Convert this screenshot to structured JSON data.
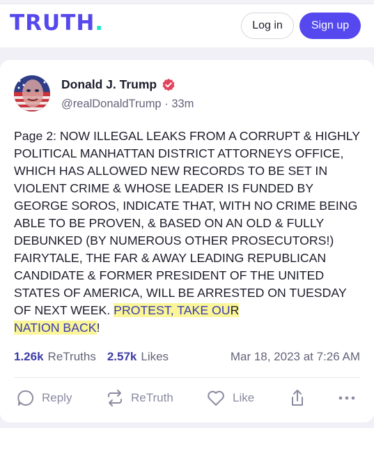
{
  "header": {
    "logo_text": "TRUTH",
    "logo_dot": ".",
    "login_label": "Log in",
    "signup_label": "Sign up",
    "brand_color": "#5448ee",
    "accent_color": "#17e6c8"
  },
  "post": {
    "author_name": "Donald J. Trump",
    "handle": "@realDonaldTrump",
    "separator": "·",
    "time_ago": "33m",
    "text_main": "Page 2: NOW ILLEGAL LEAKS FROM A CORRUPT & HIGHLY POLITICAL MANHATTAN DISTRICT ATTORNEYS OFFICE, WHICH HAS ALLOWED NEW RECORDS TO BE SET IN VIOLENT CRIME & WHOSE LEADER IS FUNDED BY GEORGE SOROS, INDICATE THAT, WITH NO CRIME BEING ABLE TO BE PROVEN, & BASED ON AN OLD & FULLY DEBUNKED (BY NUMEROUS OTHER PROSECUTORS!) FAIRYTALE, THE FAR & AWAY LEADING REPUBLICAN CANDIDATE & FORMER PRESIDENT OF THE UNITED STATES OF AMERICA, WILL BE ARRESTED ON TUESDAY OF NEXT WEEK. ",
    "text_highlight_1": "PROTEST, TAKE OU",
    "text_highlight_2": "R",
    "text_highlight_3": "NATION BACK",
    "text_end": "!",
    "retruths_count": "1.26k",
    "retruths_label": "ReTruths",
    "likes_count": "2.57k",
    "likes_label": "Likes",
    "date": "Mar 18, 2023 at 7:26 AM"
  },
  "actions": {
    "reply_label": "Reply",
    "retruth_label": "ReTruth",
    "like_label": "Like"
  },
  "icons": [
    "verified-badge-icon",
    "reply-icon",
    "retruth-icon",
    "like-icon",
    "share-icon",
    "more-icon"
  ]
}
